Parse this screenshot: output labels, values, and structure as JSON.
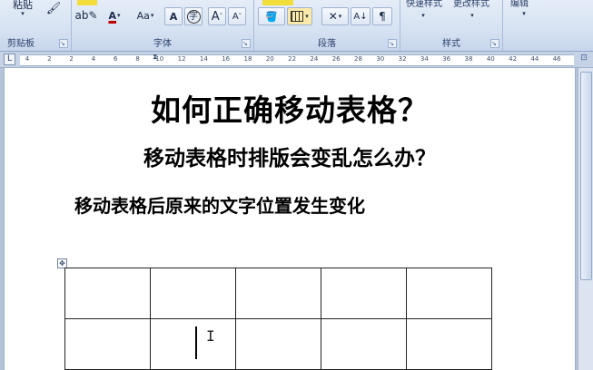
{
  "ribbon": {
    "clipboard": {
      "paste_label": "粘贴",
      "group_label": "剪贴板"
    },
    "font": {
      "group_label": "字体",
      "size_shrink": "Aa",
      "grow": "A",
      "shrink": "A",
      "enclose": "字",
      "font_color_glyph": "A",
      "change_case": "Aa"
    },
    "paragraph": {
      "group_label": "段落"
    },
    "styles": {
      "group_label": "样式",
      "quick_styles": "快速样式",
      "change_styles": "更改样式"
    },
    "editing": {
      "label": "编辑"
    }
  },
  "ruler": {
    "tab_selector": "L",
    "numbers": [
      "4",
      "2",
      "2",
      "4",
      "6",
      "8",
      "10",
      "12",
      "14",
      "16",
      "18",
      "20",
      "22",
      "24",
      "26",
      "28",
      "30",
      "32",
      "34",
      "36",
      "38",
      "40",
      "42",
      "44",
      "46"
    ]
  },
  "document": {
    "title": "如何正确移动表格？",
    "subtitle": "移动表格时排版会变乱怎么办？",
    "line3": "移动表格后原来的文字位置发生变化",
    "table": {
      "rows_visible": 2,
      "cols": 5
    }
  },
  "colors": {
    "ribbon_bg": "#d6e2f2",
    "page_bg": "#ffffff",
    "accent": "#2a3f6a"
  }
}
